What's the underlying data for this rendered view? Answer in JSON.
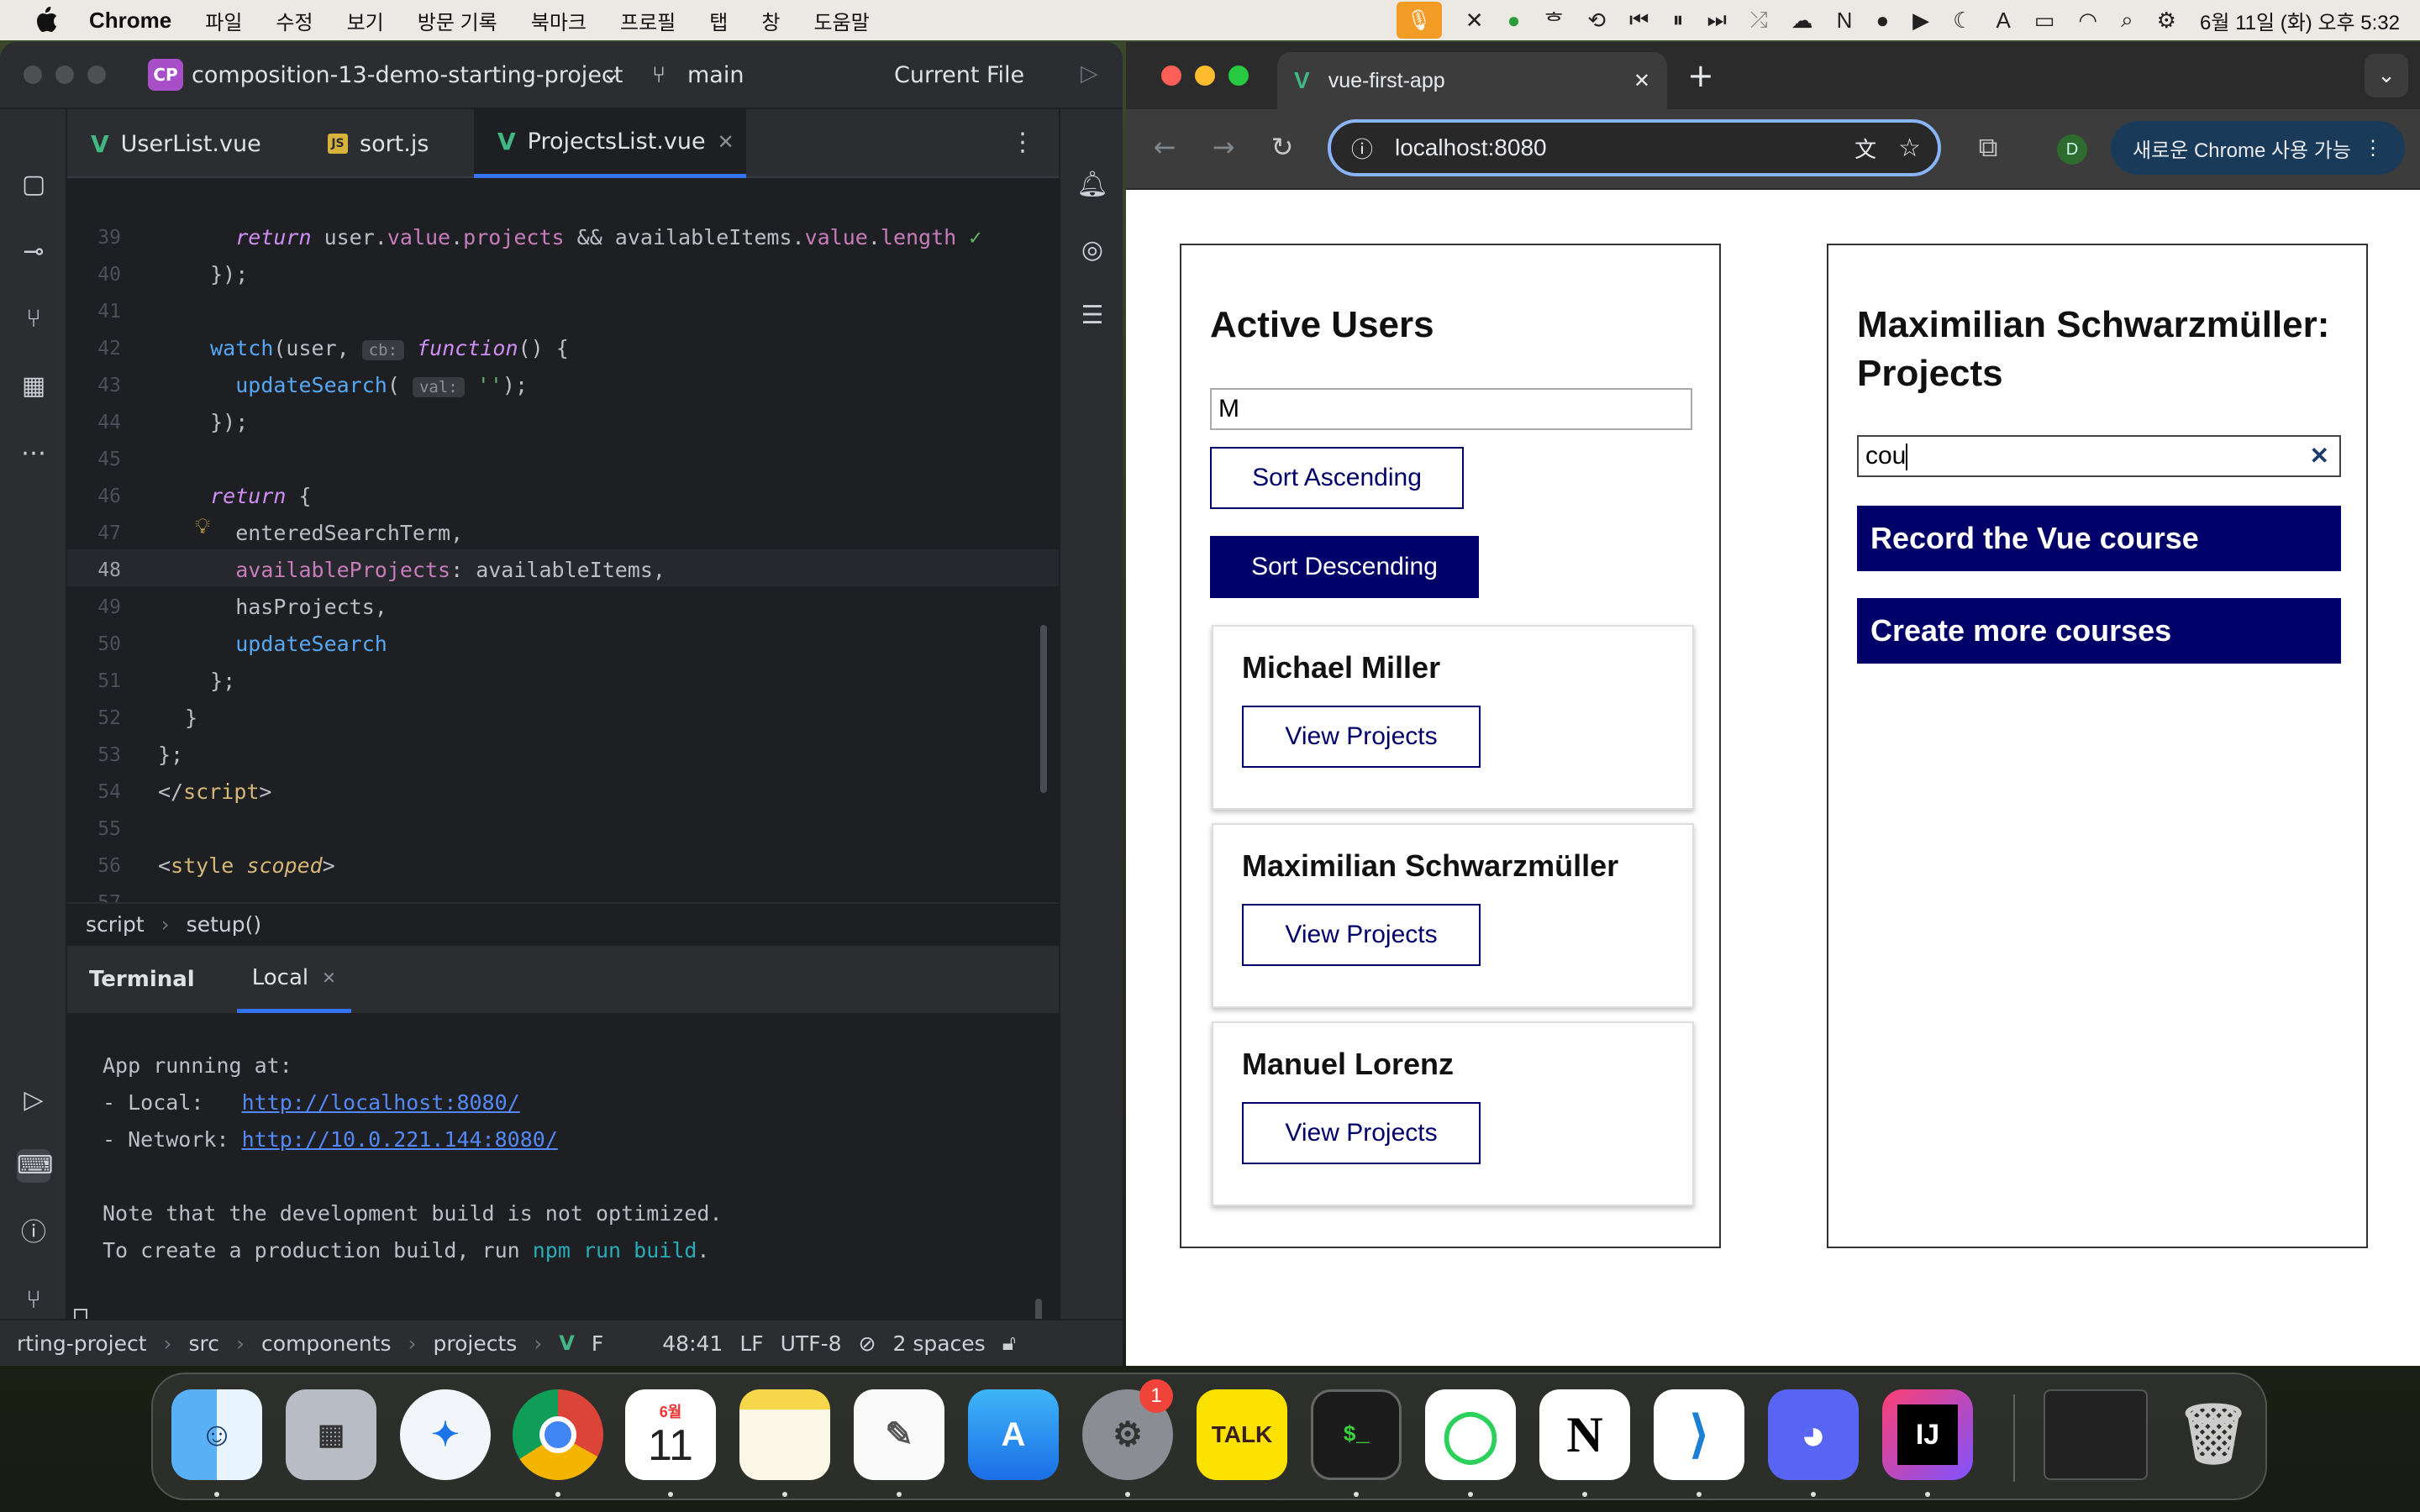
{
  "menubar": {
    "app": "Chrome",
    "items": [
      "파일",
      "수정",
      "보기",
      "방문 기록",
      "북마크",
      "프로필",
      "탭",
      "창",
      "도움말"
    ],
    "datetime": "6월 11일 (화) 오후 5:32"
  },
  "ide": {
    "project_badge": "CP",
    "project_name": "composition-13-demo-starting-project",
    "branch": "main",
    "run_config": "Current File",
    "tabs": [
      {
        "label": "UserList.vue"
      },
      {
        "label": "sort.js"
      },
      {
        "label": "ProjectsList.vue"
      }
    ],
    "hint_cb": "cb:",
    "hint_val": "val:",
    "breadcrumb": [
      "script",
      "setup()"
    ],
    "terminal": {
      "tab_terminal": "Terminal",
      "tab_local": "Local",
      "l1": "App running at:",
      "l2_label": "- Local:   ",
      "l2_link": "http://localhost:8080/",
      "l3_label": "- Network: ",
      "l3_link": "http://10.0.221.144:8080/",
      "l5": "Note that the development build is not optimized.",
      "l6_a": "To create a production build, run ",
      "l6_cmd": "npm run build",
      "l6_b": "."
    },
    "status": {
      "path": [
        "rting-project",
        "src",
        "components",
        "projects",
        "F"
      ],
      "position": "48:41",
      "line_ending": "LF",
      "encoding": "UTF-8",
      "indent": "2 spaces"
    }
  },
  "chrome": {
    "tab_title": "vue-first-app",
    "url": "localhost:8080",
    "profile_initial": "D",
    "update_label": "새로운 Chrome 사용 가능"
  },
  "app": {
    "users_title": "Active Users",
    "users_search": "M",
    "sort_asc": "Sort Ascending",
    "sort_desc": "Sort Descending",
    "view_projects": "View Projects",
    "users": [
      {
        "name": "Michael Miller"
      },
      {
        "name": "Maximilian Schwarzmüller"
      },
      {
        "name": "Manuel Lorenz"
      }
    ],
    "projects_title": "Maximilian Schwarzmüller: Projects",
    "projects_search": "cou",
    "projects": [
      {
        "title": "Record the Vue course"
      },
      {
        "title": "Create more courses"
      }
    ]
  },
  "dock": {
    "calendar_month": "6월",
    "calendar_day": "11",
    "settings_badge": "1",
    "kakao_label": "TALK",
    "intellij_label": "IJ"
  }
}
